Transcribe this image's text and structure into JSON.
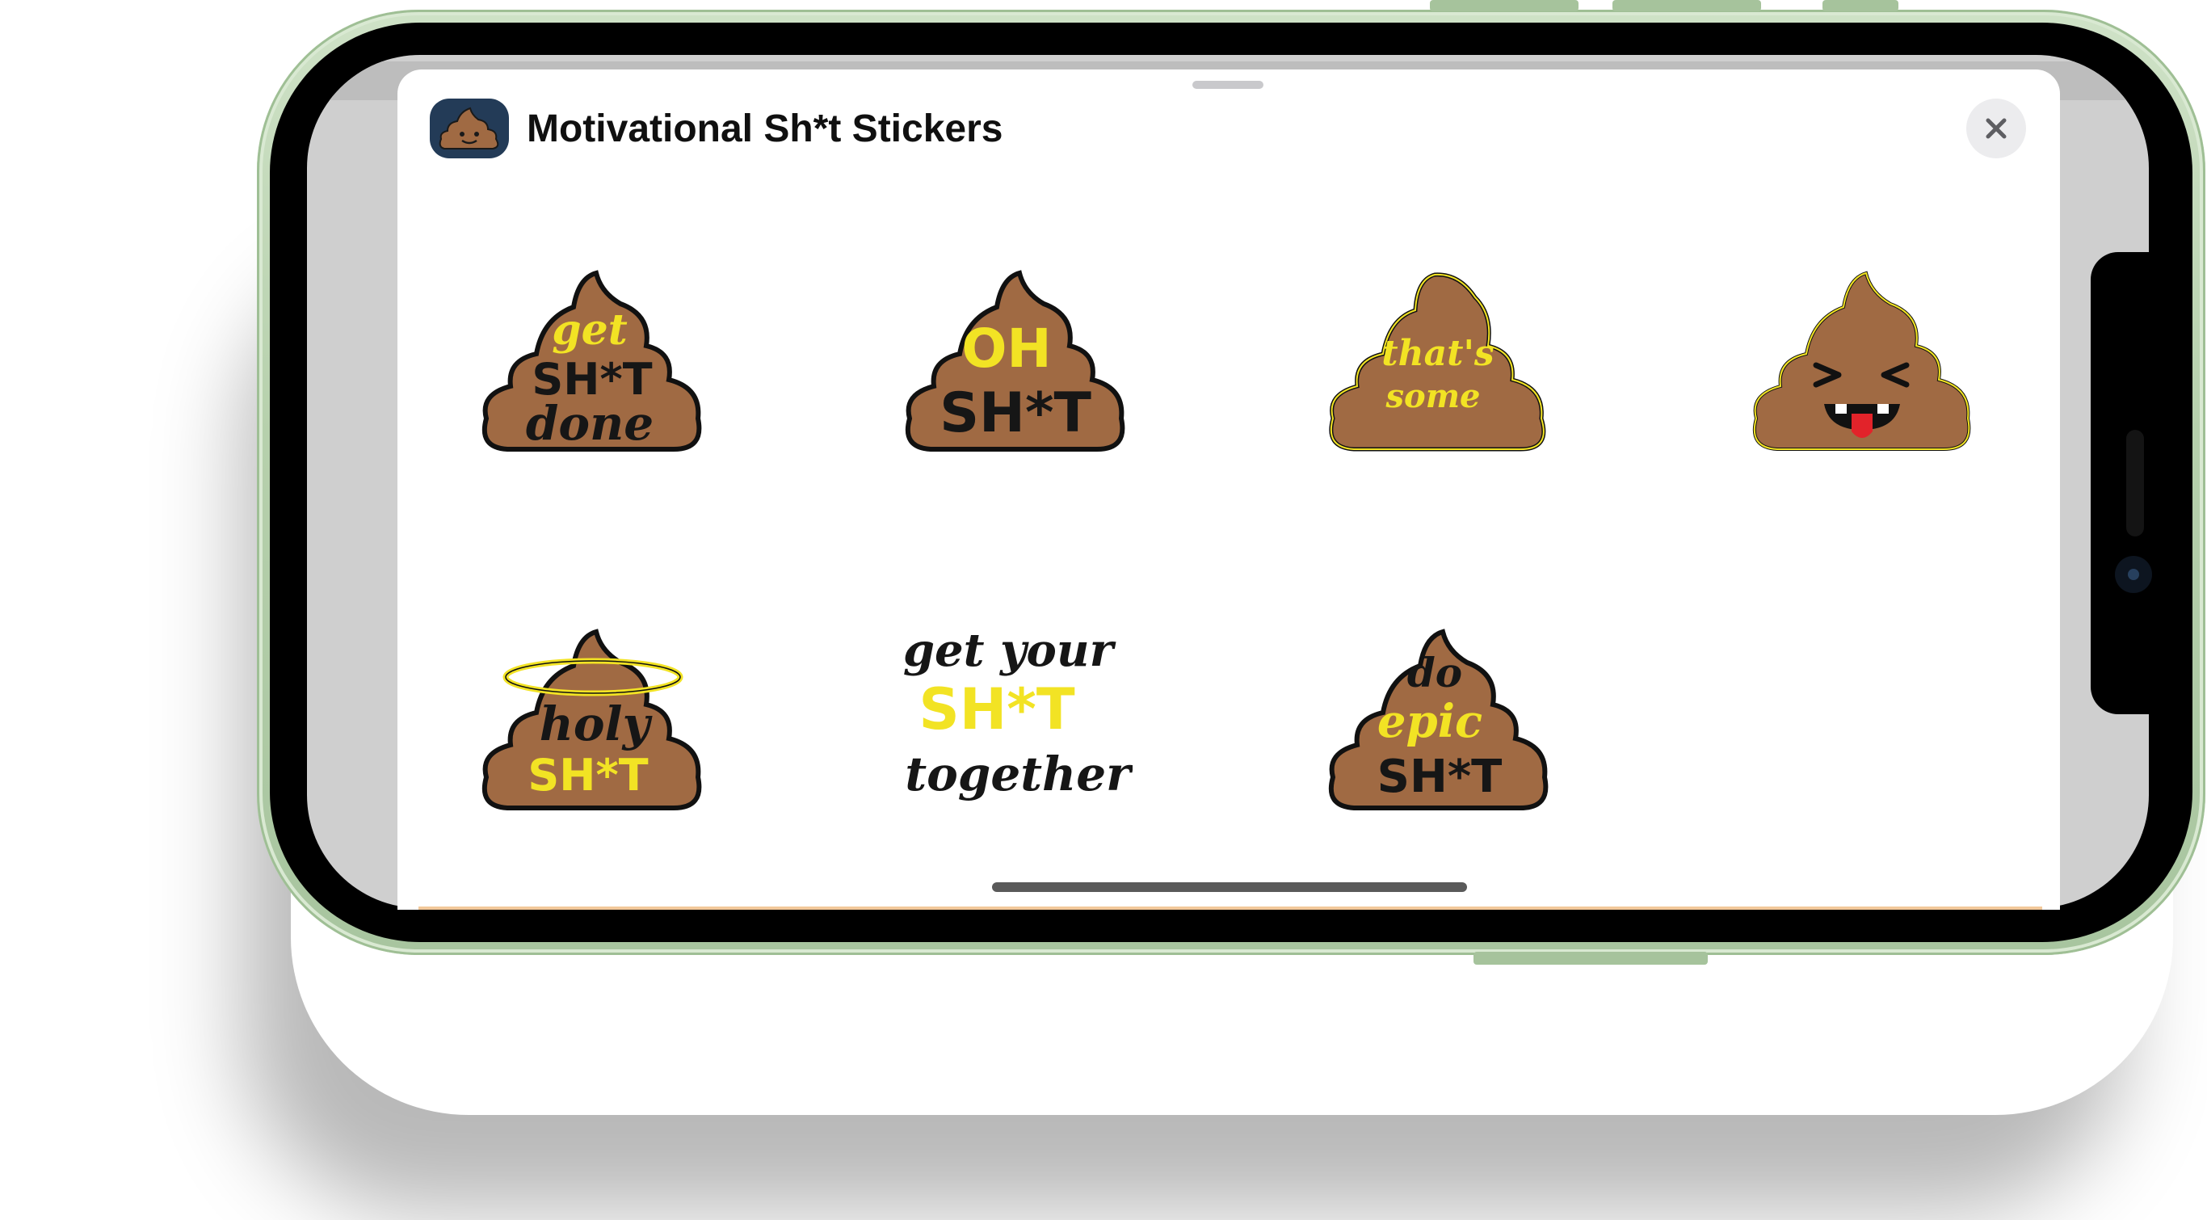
{
  "app": {
    "title": "Motivational Sh*t Stickers"
  },
  "colors": {
    "poop_brown": "#a06a43",
    "text_yellow": "#f2e324",
    "text_black": "#161616",
    "frame_green": "#b6d0ac",
    "tongue_red": "#e2232a"
  },
  "stickers": [
    {
      "lines": [
        "get",
        "SH*T",
        "done"
      ]
    },
    {
      "lines": [
        "OH",
        "SH*T"
      ]
    },
    {
      "lines": [
        "that's",
        "some"
      ]
    },
    {
      "lines": []
    },
    {
      "lines": [
        "holy",
        "SH*T"
      ]
    },
    {
      "lines": [
        "get your",
        "SH*T",
        "together"
      ]
    },
    {
      "lines": [
        "do",
        "epic",
        "SH*T"
      ]
    }
  ],
  "icons": {
    "close": "close-icon",
    "app": "app-icon"
  }
}
